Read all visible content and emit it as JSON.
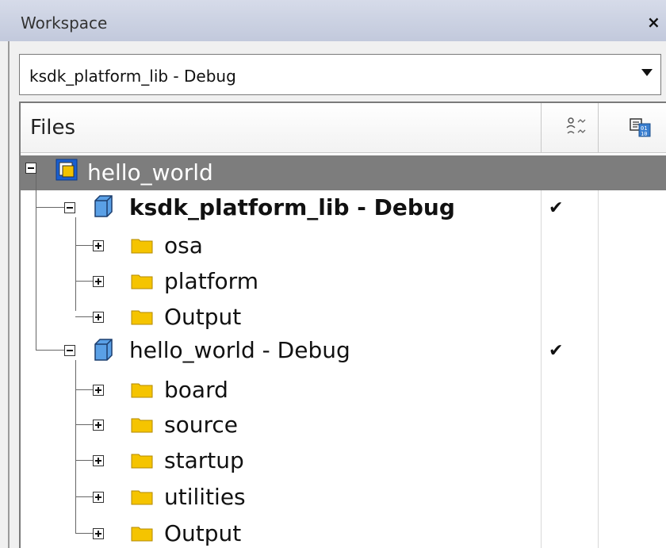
{
  "window": {
    "title": "Workspace",
    "close_glyph": "×"
  },
  "config_dropdown": {
    "value": "ksdk_platform_lib - Debug"
  },
  "file_list": {
    "header": {
      "files_label": "Files",
      "col1_icon": "options-icon",
      "col2_icon": "build-config-icon"
    },
    "check_glyph": "✔",
    "root": {
      "label": "hello_world"
    },
    "projects": [
      {
        "label": "ksdk_platform_lib - Debug",
        "checked": true,
        "bold": true,
        "folders": [
          "osa",
          "platform",
          "Output"
        ]
      },
      {
        "label": "hello_world - Debug",
        "checked": true,
        "bold": false,
        "folders": [
          "board",
          "source",
          "startup",
          "utilities",
          "Output"
        ]
      }
    ]
  },
  "colors": {
    "selection": "#7d7d7d",
    "folder": "#f5c400",
    "cube": "#5aa0e6"
  }
}
